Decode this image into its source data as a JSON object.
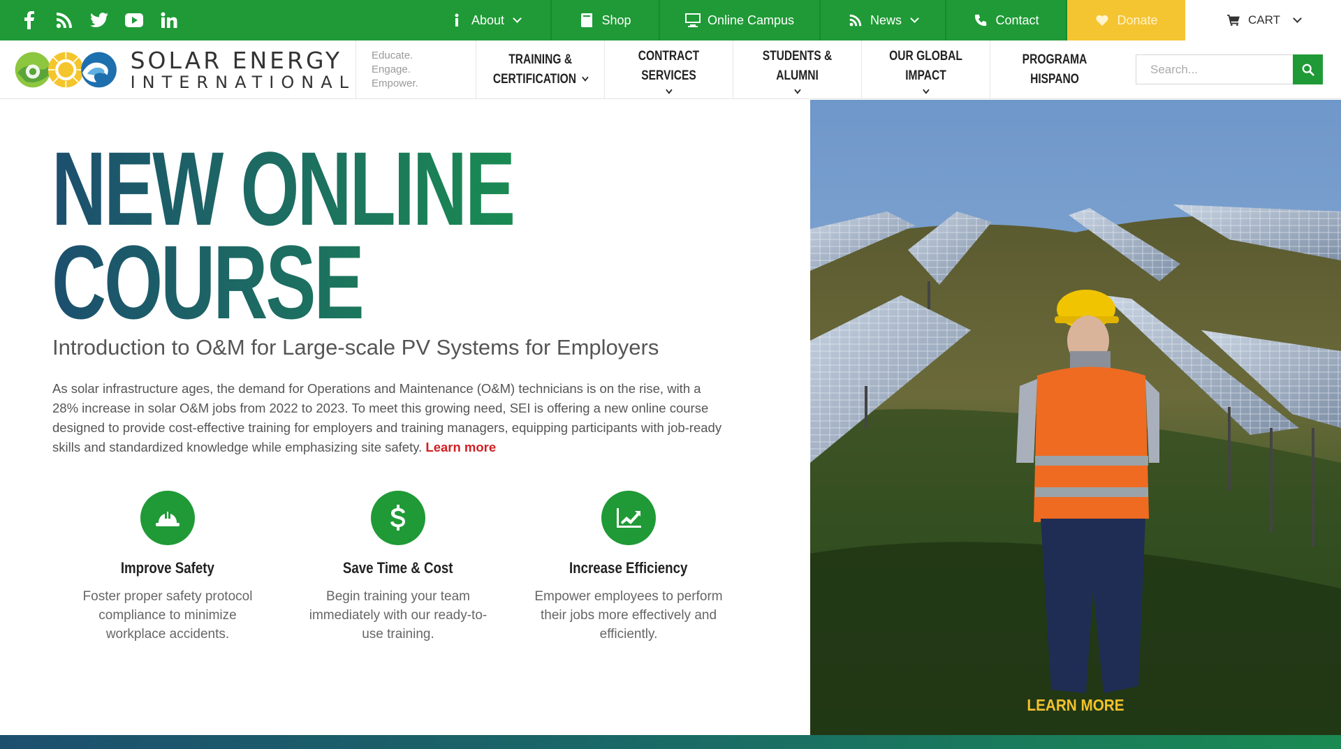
{
  "topbar": {
    "social": [
      "facebook-icon",
      "rss-icon",
      "twitter-icon",
      "youtube-icon",
      "linkedin-icon"
    ],
    "links": [
      {
        "label": "About",
        "icon": "info-icon",
        "dropdown": true
      },
      {
        "label": "Shop",
        "icon": "book-icon",
        "dropdown": false
      },
      {
        "label": "Online Campus",
        "icon": "monitor-icon",
        "dropdown": false
      },
      {
        "label": "News",
        "icon": "rss-icon",
        "dropdown": true
      },
      {
        "label": "Contact",
        "icon": "phone-icon",
        "dropdown": false
      },
      {
        "label": "Donate",
        "icon": "heart-icon",
        "dropdown": false
      }
    ],
    "cart_label": "CART",
    "colors": {
      "green": "#1f9a36",
      "donate": "#f5c431"
    }
  },
  "header": {
    "logo_line1": "SOLAR ENERGY",
    "logo_line2": "INTERNATIONAL",
    "tagline": [
      "Educate.",
      "Engage.",
      "Empower."
    ],
    "nav": [
      {
        "label_lines": [
          "TRAINING &",
          "CERTIFICATION"
        ]
      },
      {
        "label_lines": [
          "CONTRACT SERVICES"
        ]
      },
      {
        "label_lines": [
          "STUDENTS & ALUMNI"
        ]
      },
      {
        "label_lines": [
          "OUR GLOBAL IMPACT"
        ]
      },
      {
        "label_lines": [
          "PROGRAMA HISPANO"
        ]
      }
    ],
    "search_placeholder": "Search..."
  },
  "hero": {
    "headline_line1": "NEW ONLINE",
    "headline_line2": "COURSE",
    "subtitle": "Introduction to O&M for Large-scale PV Systems for Employers",
    "description": "As solar infrastructure ages, the demand for Operations and Maintenance (O&M) technicians is on the rise, with a 28% increase in solar O&M jobs from 2022 to 2023. To meet this growing need, SEI is offering a new online course designed to provide cost-effective training for employers and training managers, equipping participants with job-ready skills and standardized knowledge while emphasizing site safety.",
    "learn_more_inline": "Learn more",
    "features": [
      {
        "icon": "hard-hat-icon",
        "title": "Improve Safety",
        "text": "Foster proper safety protocol compliance to minimize workplace accidents."
      },
      {
        "icon": "dollar-icon",
        "title": "Save Time & Cost",
        "text": "Begin training your team immediately with our ready-to-use training."
      },
      {
        "icon": "chart-icon",
        "title": "Increase Efficiency",
        "text": "Empower employees to perform their jobs more effectively and efficiently."
      }
    ],
    "image_cta": "LEARN MORE"
  }
}
